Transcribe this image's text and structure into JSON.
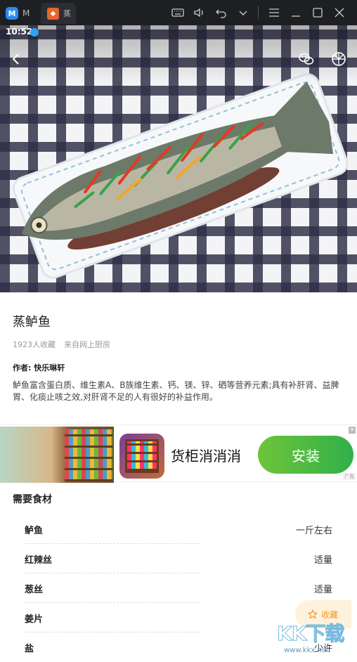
{
  "emulator": {
    "tab1_label": "M",
    "tab2_label": "蒸"
  },
  "status_bar": {
    "time": "10:52"
  },
  "recipe": {
    "title": "蒸鲈鱼",
    "collect_count": "1923人收藏",
    "source": "来自网上厨房",
    "author_label": "作者:",
    "author_name": "快乐琳轩",
    "description": "鲈鱼富含蛋白质、维生素A、B族维生素、钙、镁、锌、硒等营养元素;具有补肝肾、益脾胃、化痰止咳之效,对肝肾不足的人有很好的补益作用。"
  },
  "ad": {
    "app_name": "货柜消消消",
    "install_label": "安装",
    "ad_tag": "广告"
  },
  "ingredients": {
    "header": "需要食材",
    "items": [
      {
        "name": "鲈鱼",
        "amount": "一斤左右"
      },
      {
        "name": "红辣丝",
        "amount": "适量"
      },
      {
        "name": "葱丝",
        "amount": "适量"
      },
      {
        "name": "姜片",
        "amount": ""
      },
      {
        "name": "盐",
        "amount": "少许"
      }
    ]
  },
  "fav_button": {
    "label": "收藏"
  },
  "watermark": {
    "text": "KK下载",
    "url": "www.kkx.net"
  },
  "icons": [
    "back-icon",
    "wechat-icon",
    "moments-icon",
    "star-icon",
    "keyboard-icon",
    "volume-icon",
    "undo-icon",
    "chevron-down-icon",
    "menu-icon",
    "minimize-icon",
    "maximize-icon",
    "close-icon"
  ],
  "colors": {
    "install_green": "#30b04a",
    "fav_orange": "#f0962b"
  }
}
